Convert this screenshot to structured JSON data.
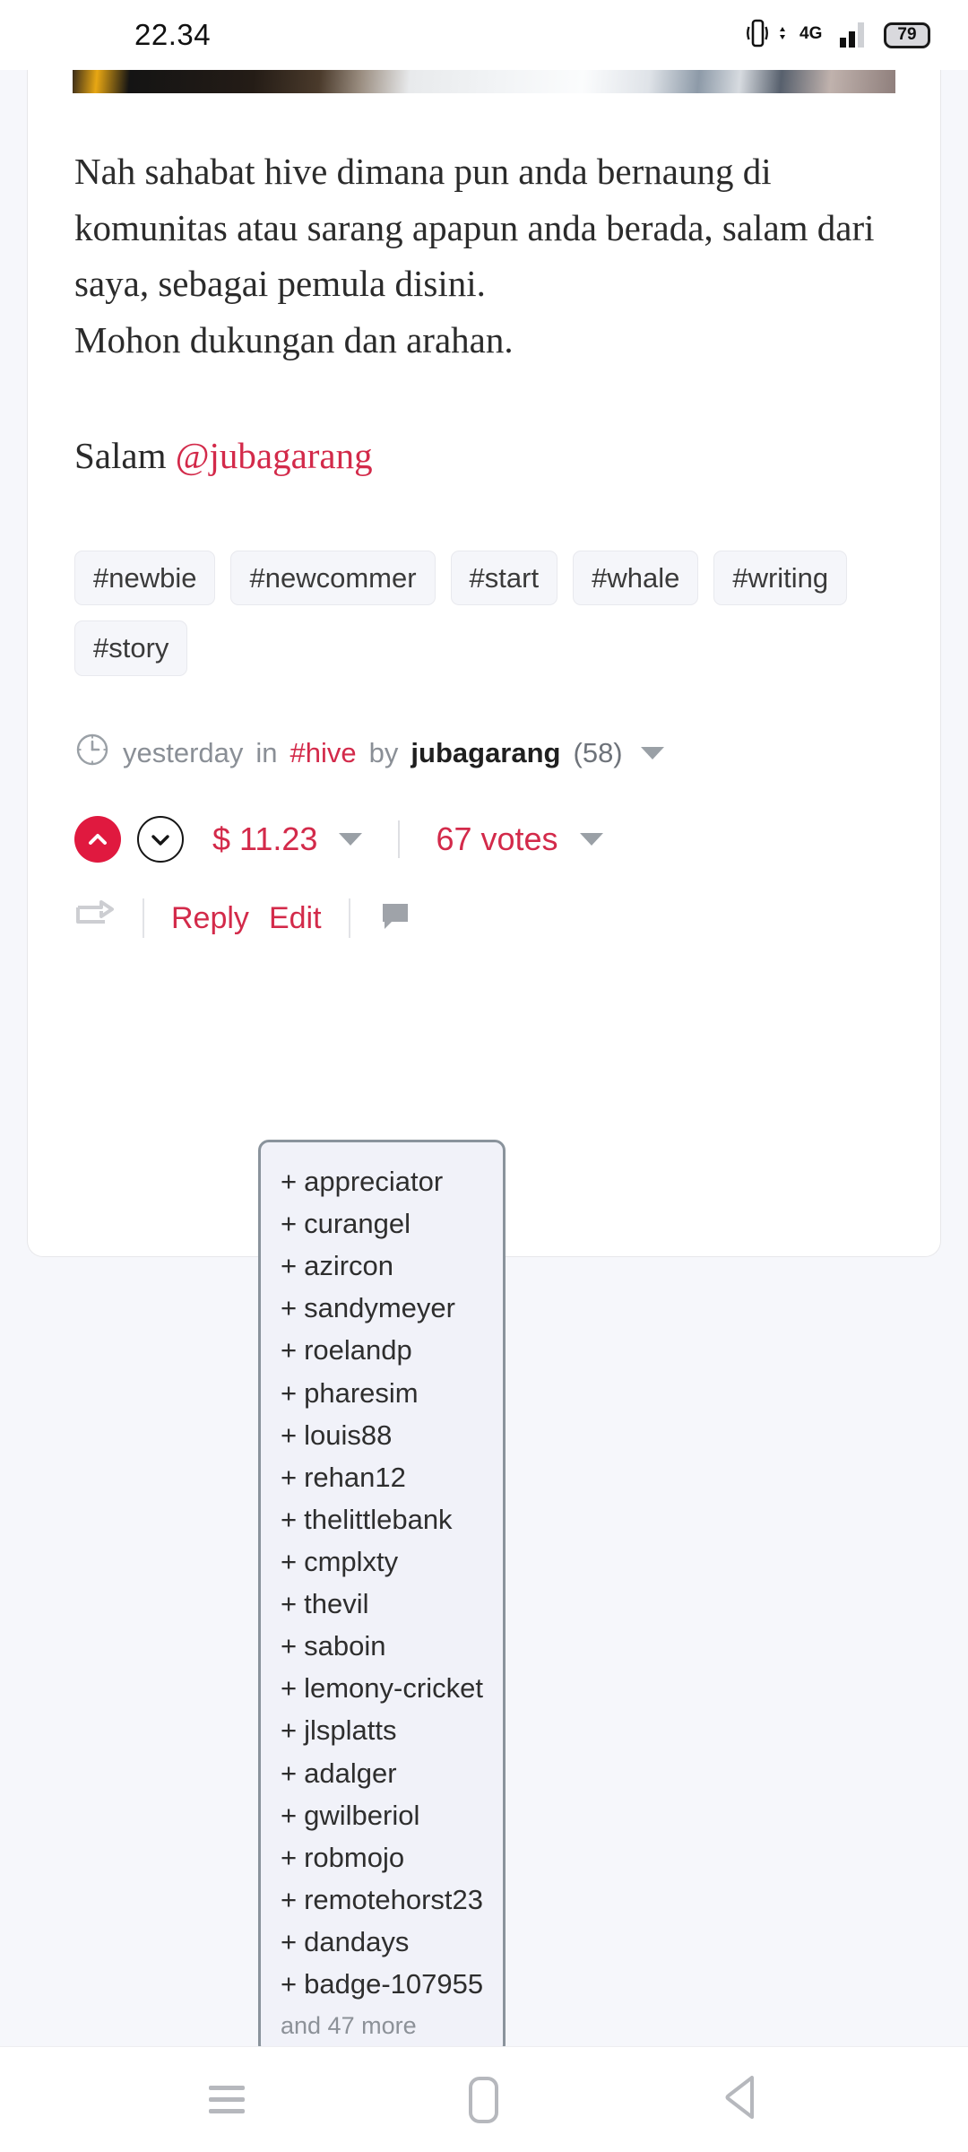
{
  "statusbar": {
    "time": "22.34",
    "network": "4G",
    "battery": "79",
    "icons": {
      "vibrate": "vibrate-icon",
      "signal": "signal-bars-icon",
      "battery": "battery-icon"
    }
  },
  "post": {
    "paragraphs": [
      "Nah sahabat hive dimana pun anda bernaung di komunitas atau sarang apapun anda berada, salam dari saya, sebagai pemula disini.",
      "Mohon dukungan dan arahan."
    ],
    "signature_prefix": "Salam ",
    "signature_mention": "@jubagarang",
    "tags": [
      "#newbie",
      "#newcommer",
      "#start",
      "#whale",
      "#writing",
      "#story"
    ],
    "meta": {
      "clock_icon": "clock-icon",
      "time_ago": "yesterday",
      "in_label": "in",
      "community": "#hive",
      "by_label": "by",
      "author": "jubagarang",
      "reputation": "(58)"
    },
    "vote": {
      "upvote_icon": "chevron-up-icon",
      "downvote_icon": "chevron-down-icon",
      "payout": "$ 11.23",
      "votes": "67 votes"
    },
    "actions": {
      "reshare_icon": "reshare-icon",
      "reply_label": "Reply",
      "edit_label": "Edit",
      "comment_icon": "comment-icon"
    }
  },
  "voters_popup": {
    "names": [
      "appreciator",
      "curangel",
      "azircon",
      "sandymeyer",
      "roelandp",
      "pharesim",
      "louis88",
      "rehan12",
      "thelittlebank",
      "cmplxty",
      "thevil",
      "saboin",
      "lemony-cricket",
      "jlsplatts",
      "adalger",
      "gwilberiol",
      "robmojo",
      "remotehorst23",
      "dandays",
      "badge-107955"
    ],
    "plus": "+",
    "more_label": "and 47 more"
  },
  "navbar": {
    "recents": "recents-icon",
    "home": "home-icon",
    "back": "back-icon"
  },
  "colors": {
    "accent_red": "#d32a4a",
    "upvote_red": "#e0193f",
    "page_bg": "#f6f7fb",
    "popup_bg": "#f1f2f9",
    "muted": "#8a8f96"
  }
}
